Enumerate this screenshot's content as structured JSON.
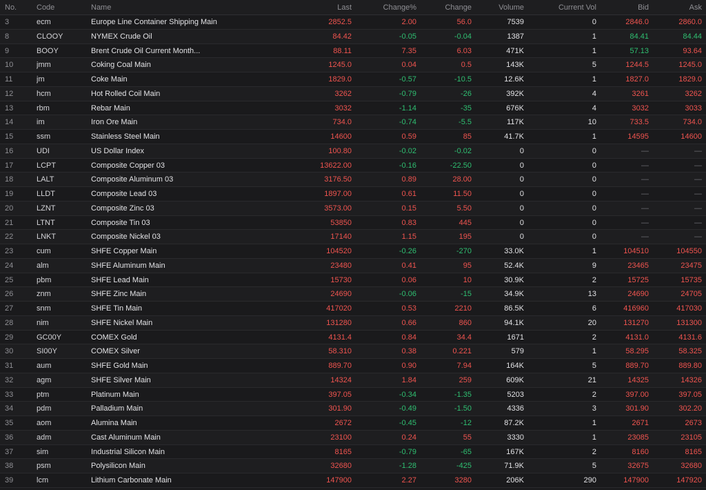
{
  "colors": {
    "up": "#f0544f",
    "down": "#2fbf71",
    "flat": "#6c6c72",
    "background": "#1b1b1d"
  },
  "columns": {
    "no": "No.",
    "code": "Code",
    "name": "Name",
    "last": "Last",
    "change_pct": "Change%",
    "change": "Change",
    "volume": "Volume",
    "current_vol": "Current Vol",
    "bid": "Bid",
    "ask": "Ask"
  },
  "rows": [
    {
      "no": "3",
      "code": "ecm",
      "name": "Europe Line Container Shipping Main",
      "last": "2852.5",
      "change_pct": "2.00",
      "change": "56.0",
      "volume": "7539",
      "current_vol": "0",
      "bid": "2846.0",
      "ask": "2860.0",
      "dir": "up",
      "bid_dir": "up",
      "ask_dir": "up"
    },
    {
      "no": "8",
      "code": "CLOOY",
      "name": "NYMEX Crude Oil",
      "last": "84.42",
      "change_pct": "-0.05",
      "change": "-0.04",
      "volume": "1387",
      "current_vol": "1",
      "bid": "84.41",
      "ask": "84.44",
      "dir": "up",
      "chg_dir": "down",
      "bid_dir": "down",
      "ask_dir": "down"
    },
    {
      "no": "9",
      "code": "BOOY",
      "name": "Brent Crude Oil Current Month...",
      "last": "88.11",
      "change_pct": "7.35",
      "change": "6.03",
      "volume": "471K",
      "current_vol": "1",
      "bid": "57.13",
      "ask": "93.64",
      "dir": "up",
      "bid_dir": "down",
      "ask_dir": "up"
    },
    {
      "no": "10",
      "code": "jmm",
      "name": "Coking Coal Main",
      "last": "1245.0",
      "change_pct": "0.04",
      "change": "0.5",
      "volume": "143K",
      "current_vol": "5",
      "bid": "1244.5",
      "ask": "1245.0",
      "dir": "up",
      "bid_dir": "up",
      "ask_dir": "up"
    },
    {
      "no": "11",
      "code": "jm",
      "name": "Coke Main",
      "last": "1829.0",
      "change_pct": "-0.57",
      "change": "-10.5",
      "volume": "12.6K",
      "current_vol": "1",
      "bid": "1827.0",
      "ask": "1829.0",
      "dir": "up",
      "chg_dir": "down",
      "bid_dir": "up",
      "ask_dir": "up"
    },
    {
      "no": "12",
      "code": "hcm",
      "name": "Hot Rolled Coil Main",
      "last": "3262",
      "change_pct": "-0.79",
      "change": "-26",
      "volume": "392K",
      "current_vol": "4",
      "bid": "3261",
      "ask": "3262",
      "dir": "up",
      "chg_dir": "down",
      "bid_dir": "up",
      "ask_dir": "up"
    },
    {
      "no": "13",
      "code": "rbm",
      "name": "Rebar Main",
      "last": "3032",
      "change_pct": "-1.14",
      "change": "-35",
      "volume": "676K",
      "current_vol": "4",
      "bid": "3032",
      "ask": "3033",
      "dir": "up",
      "chg_dir": "down",
      "bid_dir": "up",
      "ask_dir": "up"
    },
    {
      "no": "14",
      "code": "im",
      "name": "Iron Ore Main",
      "last": "734.0",
      "change_pct": "-0.74",
      "change": "-5.5",
      "volume": "117K",
      "current_vol": "10",
      "bid": "733.5",
      "ask": "734.0",
      "dir": "up",
      "chg_dir": "down",
      "bid_dir": "up",
      "ask_dir": "up"
    },
    {
      "no": "15",
      "code": "ssm",
      "name": "Stainless Steel Main",
      "last": "14600",
      "change_pct": "0.59",
      "change": "85",
      "volume": "41.7K",
      "current_vol": "1",
      "bid": "14595",
      "ask": "14600",
      "dir": "up",
      "bid_dir": "up",
      "ask_dir": "up"
    },
    {
      "no": "16",
      "code": "UDI",
      "name": "US Dollar Index",
      "last": "100.80",
      "change_pct": "-0.02",
      "change": "-0.02",
      "volume": "0",
      "current_vol": "0",
      "bid": "—",
      "ask": "—",
      "dir": "up",
      "chg_dir": "down",
      "bid_dir": "flat",
      "ask_dir": "flat"
    },
    {
      "no": "17",
      "code": "LCPT",
      "name": "Composite Copper 03",
      "last": "13622.00",
      "change_pct": "-0.16",
      "change": "-22.50",
      "volume": "0",
      "current_vol": "0",
      "bid": "—",
      "ask": "—",
      "dir": "up",
      "chg_dir": "down",
      "bid_dir": "flat",
      "ask_dir": "flat"
    },
    {
      "no": "18",
      "code": "LALT",
      "name": "Composite Aluminum 03",
      "last": "3176.50",
      "change_pct": "0.89",
      "change": "28.00",
      "volume": "0",
      "current_vol": "0",
      "bid": "—",
      "ask": "—",
      "dir": "up",
      "bid_dir": "flat",
      "ask_dir": "flat"
    },
    {
      "no": "19",
      "code": "LLDT",
      "name": "Composite Lead 03",
      "last": "1897.00",
      "change_pct": "0.61",
      "change": "11.50",
      "volume": "0",
      "current_vol": "0",
      "bid": "—",
      "ask": "—",
      "dir": "up",
      "bid_dir": "flat",
      "ask_dir": "flat"
    },
    {
      "no": "20",
      "code": "LZNT",
      "name": "Composite Zinc 03",
      "last": "3573.00",
      "change_pct": "0.15",
      "change": "5.50",
      "volume": "0",
      "current_vol": "0",
      "bid": "—",
      "ask": "—",
      "dir": "up",
      "bid_dir": "flat",
      "ask_dir": "flat"
    },
    {
      "no": "21",
      "code": "LTNT",
      "name": "Composite Tin 03",
      "last": "53850",
      "change_pct": "0.83",
      "change": "445",
      "volume": "0",
      "current_vol": "0",
      "bid": "—",
      "ask": "—",
      "dir": "up",
      "bid_dir": "flat",
      "ask_dir": "flat"
    },
    {
      "no": "22",
      "code": "LNKT",
      "name": "Composite Nickel 03",
      "last": "17140",
      "change_pct": "1.15",
      "change": "195",
      "volume": "0",
      "current_vol": "0",
      "bid": "—",
      "ask": "—",
      "dir": "up",
      "bid_dir": "flat",
      "ask_dir": "flat"
    },
    {
      "no": "23",
      "code": "cum",
      "name": "SHFE Copper Main",
      "last": "104520",
      "change_pct": "-0.26",
      "change": "-270",
      "volume": "33.0K",
      "current_vol": "1",
      "bid": "104510",
      "ask": "104550",
      "dir": "up",
      "chg_dir": "down",
      "bid_dir": "up",
      "ask_dir": "up"
    },
    {
      "no": "24",
      "code": "alm",
      "name": "SHFE Aluminum Main",
      "last": "23480",
      "change_pct": "0.41",
      "change": "95",
      "volume": "52.4K",
      "current_vol": "9",
      "bid": "23465",
      "ask": "23475",
      "dir": "up",
      "bid_dir": "up",
      "ask_dir": "up"
    },
    {
      "no": "25",
      "code": "pbm",
      "name": "SHFE Lead Main",
      "last": "15730",
      "change_pct": "0.06",
      "change": "10",
      "volume": "30.9K",
      "current_vol": "2",
      "bid": "15725",
      "ask": "15735",
      "dir": "up",
      "bid_dir": "up",
      "ask_dir": "up"
    },
    {
      "no": "26",
      "code": "znm",
      "name": "SHFE Zinc Main",
      "last": "24690",
      "change_pct": "-0.06",
      "change": "-15",
      "volume": "34.9K",
      "current_vol": "13",
      "bid": "24690",
      "ask": "24705",
      "dir": "up",
      "chg_dir": "down",
      "bid_dir": "up",
      "ask_dir": "up"
    },
    {
      "no": "27",
      "code": "snm",
      "name": "SHFE Tin Main",
      "last": "417020",
      "change_pct": "0.53",
      "change": "2210",
      "volume": "86.5K",
      "current_vol": "6",
      "bid": "416960",
      "ask": "417030",
      "dir": "up",
      "bid_dir": "up",
      "ask_dir": "up"
    },
    {
      "no": "28",
      "code": "nim",
      "name": "SHFE Nickel Main",
      "last": "131280",
      "change_pct": "0.66",
      "change": "860",
      "volume": "94.1K",
      "current_vol": "20",
      "bid": "131270",
      "ask": "131300",
      "dir": "up",
      "bid_dir": "up",
      "ask_dir": "up"
    },
    {
      "no": "29",
      "code": "GC00Y",
      "name": "COMEX Gold",
      "last": "4131.4",
      "change_pct": "0.84",
      "change": "34.4",
      "volume": "1671",
      "current_vol": "2",
      "bid": "4131.0",
      "ask": "4131.6",
      "dir": "up",
      "bid_dir": "up",
      "ask_dir": "up"
    },
    {
      "no": "30",
      "code": "SI00Y",
      "name": "COMEX Silver",
      "last": "58.310",
      "change_pct": "0.38",
      "change": "0.221",
      "volume": "579",
      "current_vol": "1",
      "bid": "58.295",
      "ask": "58.325",
      "dir": "up",
      "bid_dir": "up",
      "ask_dir": "up"
    },
    {
      "no": "31",
      "code": "aum",
      "name": "SHFE Gold Main",
      "last": "889.70",
      "change_pct": "0.90",
      "change": "7.94",
      "volume": "164K",
      "current_vol": "5",
      "bid": "889.70",
      "ask": "889.80",
      "dir": "up",
      "bid_dir": "up",
      "ask_dir": "up"
    },
    {
      "no": "32",
      "code": "agm",
      "name": "SHFE Silver Main",
      "last": "14324",
      "change_pct": "1.84",
      "change": "259",
      "volume": "609K",
      "current_vol": "21",
      "bid": "14325",
      "ask": "14326",
      "dir": "up",
      "bid_dir": "up",
      "ask_dir": "up"
    },
    {
      "no": "33",
      "code": "ptm",
      "name": "Platinum Main",
      "last": "397.05",
      "change_pct": "-0.34",
      "change": "-1.35",
      "volume": "5203",
      "current_vol": "2",
      "bid": "397.00",
      "ask": "397.05",
      "dir": "up",
      "chg_dir": "down",
      "bid_dir": "up",
      "ask_dir": "up"
    },
    {
      "no": "34",
      "code": "pdm",
      "name": "Palladium Main",
      "last": "301.90",
      "change_pct": "-0.49",
      "change": "-1.50",
      "volume": "4336",
      "current_vol": "3",
      "bid": "301.90",
      "ask": "302.20",
      "dir": "up",
      "chg_dir": "down",
      "bid_dir": "up",
      "ask_dir": "up"
    },
    {
      "no": "35",
      "code": "aom",
      "name": "Alumina Main",
      "last": "2672",
      "change_pct": "-0.45",
      "change": "-12",
      "volume": "87.2K",
      "current_vol": "1",
      "bid": "2671",
      "ask": "2673",
      "dir": "up",
      "chg_dir": "down",
      "bid_dir": "up",
      "ask_dir": "up"
    },
    {
      "no": "36",
      "code": "adm",
      "name": "Cast Aluminum Main",
      "last": "23100",
      "change_pct": "0.24",
      "change": "55",
      "volume": "3330",
      "current_vol": "1",
      "bid": "23085",
      "ask": "23105",
      "dir": "up",
      "bid_dir": "up",
      "ask_dir": "up"
    },
    {
      "no": "37",
      "code": "sim",
      "name": "Industrial Silicon Main",
      "last": "8165",
      "change_pct": "-0.79",
      "change": "-65",
      "volume": "167K",
      "current_vol": "2",
      "bid": "8160",
      "ask": "8165",
      "dir": "up",
      "chg_dir": "down",
      "bid_dir": "up",
      "ask_dir": "up"
    },
    {
      "no": "38",
      "code": "psm",
      "name": "Polysilicon Main",
      "last": "32680",
      "change_pct": "-1.28",
      "change": "-425",
      "volume": "71.9K",
      "current_vol": "5",
      "bid": "32675",
      "ask": "32680",
      "dir": "up",
      "chg_dir": "down",
      "bid_dir": "up",
      "ask_dir": "up"
    },
    {
      "no": "39",
      "code": "lcm",
      "name": "Lithium Carbonate Main",
      "last": "147900",
      "change_pct": "2.27",
      "change": "3280",
      "volume": "206K",
      "current_vol": "290",
      "bid": "147900",
      "ask": "147920",
      "dir": "up",
      "bid_dir": "up",
      "ask_dir": "up"
    }
  ]
}
